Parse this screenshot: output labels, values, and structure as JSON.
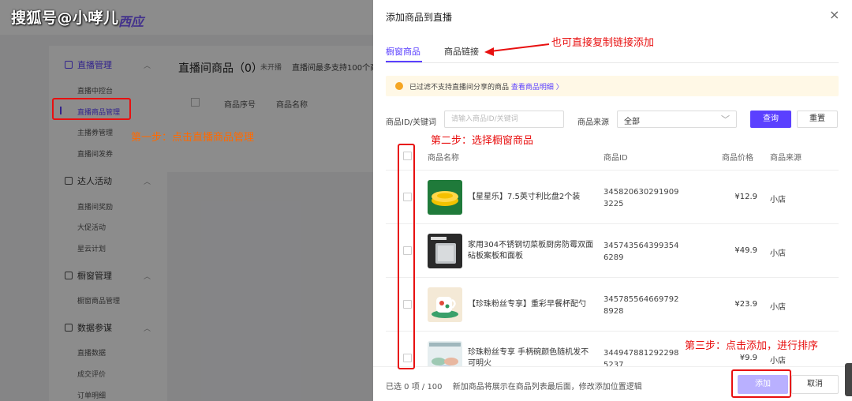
{
  "watermark": "搜狐号@小哮儿",
  "sidebar": {
    "groups": [
      {
        "label": "直播管理",
        "items": [
          "直播中控台",
          "直播商品管理",
          "主播券管理",
          "直播间发券"
        ]
      },
      {
        "label": "达人活动",
        "items": [
          "直播间奖励",
          "大促活动",
          "星云计划"
        ]
      },
      {
        "label": "橱窗管理",
        "items": [
          "橱窗商品管理"
        ]
      },
      {
        "label": "数据参谋",
        "items": [
          "直播数据",
          "成交评价",
          "订单明细"
        ]
      }
    ]
  },
  "main": {
    "title": "直播间商品（0）",
    "tag": "未开播",
    "note": "直播间最多支持100个商",
    "columns": [
      "商品序号",
      "商品名称"
    ]
  },
  "drawer": {
    "title": "添加商品到直播",
    "close": "×",
    "tabs": [
      "橱窗商品",
      "商品链接"
    ],
    "notice": "已过滤不支持直播间分享的商品",
    "notice_link": "查看商品明细 〉",
    "filter": {
      "id_label": "商品ID/关键词",
      "id_placeholder": "请输入商品ID/关键词",
      "source_label": "商品来源",
      "source_value": "全部",
      "query_button": "查询",
      "reset_button": "重置"
    },
    "table": {
      "columns": [
        "商品名称",
        "商品ID",
        "商品价格",
        "商品来源"
      ],
      "rows": [
        {
          "name": "【星星乐】7.5英寸利比盘2个装",
          "id": "3458206302919093225",
          "price": "¥12.9",
          "source": "小店"
        },
        {
          "name": "家用304不锈钢切菜板厨房防霉双面砧板案板和面板",
          "id": "3457435643993546289",
          "price": "¥49.9",
          "source": "小店"
        },
        {
          "name": "【珍珠粉丝专享】重彩早餐杯配勺",
          "id": "3457855646697928928",
          "price": "¥23.9",
          "source": "小店"
        },
        {
          "name": "珍珠粉丝专享 手柄碗颜色随机发不可明火",
          "id": "3449478812922985237",
          "price": "¥9.9",
          "source": "小店"
        }
      ]
    },
    "footer": {
      "selected": "已选 0 项 / 100",
      "hint": "新加商品将展示在商品列表最后面，修改添加位置逻辑",
      "add_button": "添加",
      "cancel_button": "取消"
    }
  },
  "annotations": {
    "step1": "第一步：点击直播商品管理",
    "step2": "第二步：选择橱窗商品",
    "step3": "第三步：点击添加，进行排序",
    "link_tip": "也可直接复制链接添加"
  },
  "colors": {
    "accent": "#5b40ff",
    "annotation_orange": "#ff6a00",
    "annotation_red": "#e81010"
  }
}
